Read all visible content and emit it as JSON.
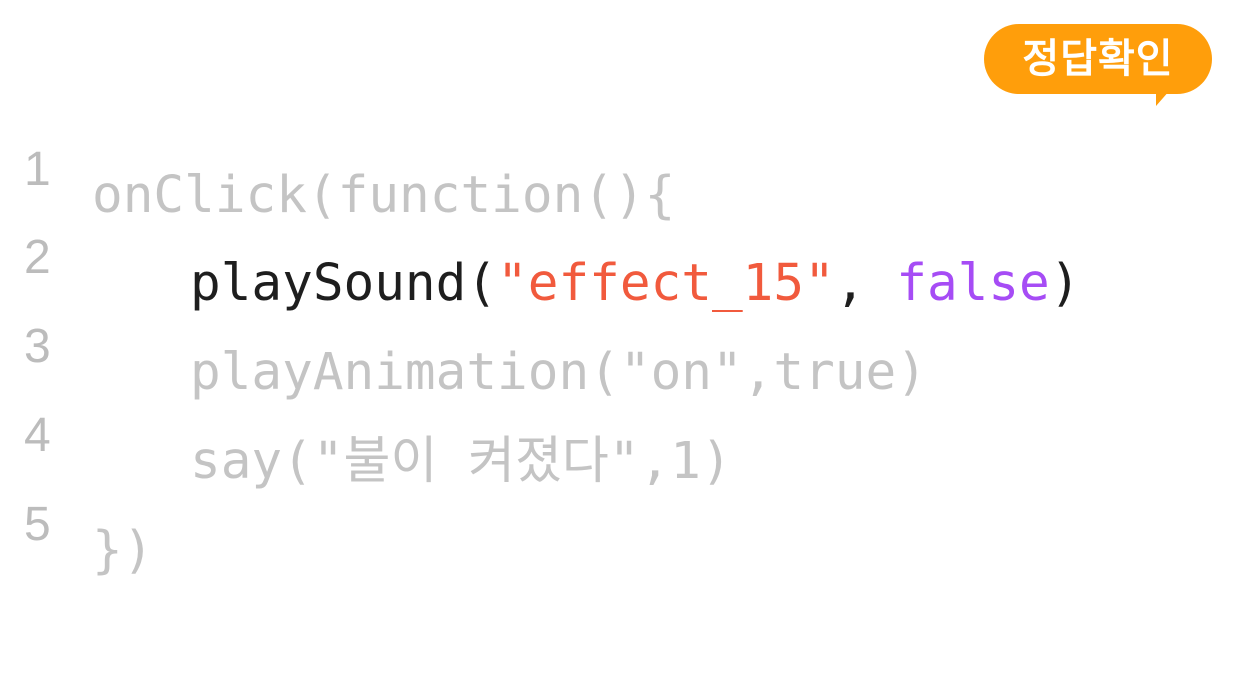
{
  "answer_button": {
    "label": "정답확인"
  },
  "colors": {
    "badge": "#ff9e0b",
    "string": "#f15a3d",
    "keyword": "#a64cf5",
    "dim": "#c4c4c4",
    "active": "#1e1e1e"
  },
  "code": {
    "lines": [
      {
        "number": "1",
        "text": "onClick(function(){"
      },
      {
        "number": "2",
        "tokens": {
          "fn": "playSound(",
          "str": "\"effect_15\"",
          "sep": ", ",
          "kw": "false",
          "close": ")"
        }
      },
      {
        "number": "3",
        "text": "playAnimation(\"on\",true)"
      },
      {
        "number": "4",
        "text": "say(\"불이 켜졌다\",1)"
      },
      {
        "number": "5",
        "text": "})"
      }
    ]
  }
}
